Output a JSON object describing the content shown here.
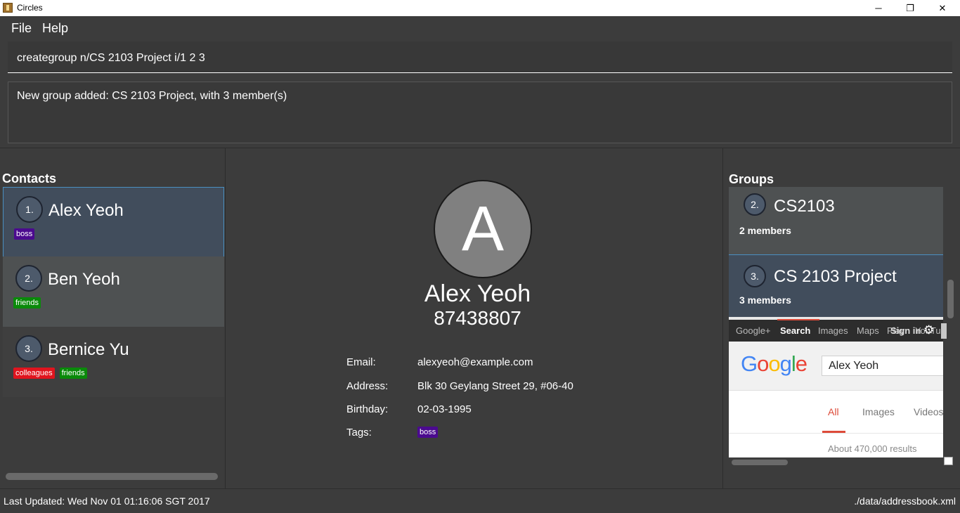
{
  "window": {
    "title": "Circles",
    "minimize": "─",
    "maximize": "❐",
    "close": "✕"
  },
  "menu": {
    "file": "File",
    "help": "Help"
  },
  "command": {
    "value": "creategroup n/CS 2103 Project i/1 2 3"
  },
  "result": {
    "message": "New group added: CS 2103 Project, with 3 member(s)"
  },
  "contacts": {
    "title": "Contacts",
    "items": [
      {
        "index": "1.",
        "name": "Alex Yeoh",
        "tags": [
          {
            "label": "boss",
            "color": "#4b0a8f"
          }
        ]
      },
      {
        "index": "2.",
        "name": "Ben Yeoh",
        "tags": [
          {
            "label": "friends",
            "color": "#0a8a0a"
          }
        ]
      },
      {
        "index": "3.",
        "name": "Bernice Yu",
        "tags": [
          {
            "label": "colleagues",
            "color": "#e0141e"
          },
          {
            "label": "friends",
            "color": "#0a8a0a"
          }
        ]
      }
    ]
  },
  "profile": {
    "avatar_letter": "A",
    "name": "Alex Yeoh",
    "phone": "87438807",
    "labels": {
      "email": "Email:",
      "address": "Address:",
      "birthday": "Birthday:",
      "tags": "Tags:"
    },
    "email": "alexyeoh@example.com",
    "address": "Blk 30 Geylang Street 29, #06-40",
    "birthday": "02-03-1995",
    "tag": "boss"
  },
  "groups": {
    "title": "Groups",
    "items": [
      {
        "index": "2.",
        "name": "CS2103",
        "count": "2 members"
      },
      {
        "index": "3.",
        "name": "CS 2103 Project",
        "count": "3 members"
      }
    ]
  },
  "browser": {
    "gbar": {
      "plus": "Google+",
      "search": "Search",
      "images": "Images",
      "maps": "Maps",
      "signin": "Sign in",
      "play": "Play",
      "youtube": "YouTube"
    },
    "query": "Alex Yeoh",
    "tabs": {
      "all": "All",
      "images": "Images",
      "videos": "Videos"
    },
    "results": "About 470,000 results",
    "logo": {
      "G": "G",
      "o1": "o",
      "o2": "o",
      "g": "g",
      "l": "l",
      "e": "e"
    }
  },
  "status": {
    "last_updated": "Last Updated: Wed Nov 01 01:16:06 SGT 2017",
    "path": "./data/addressbook.xml"
  }
}
